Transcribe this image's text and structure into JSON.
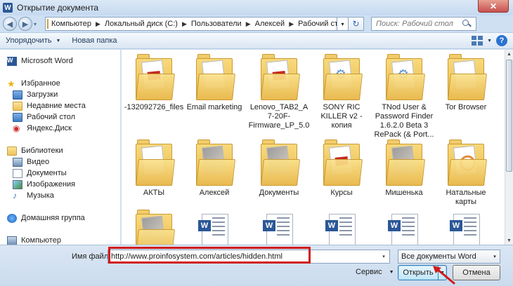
{
  "window": {
    "title": "Открытие документа",
    "close_glyph": "✕"
  },
  "nav_buttons": {
    "back": "◀",
    "forward": "▶",
    "dropdown": "▾"
  },
  "address": {
    "crumbs": [
      "Компьютер",
      "Локальный диск (C:)",
      "Пользователи",
      "Алексей",
      "Рабочий стол"
    ],
    "separator": "▶",
    "dropdown": "▾",
    "refresh": "↻"
  },
  "search": {
    "placeholder": "Поиск: Рабочий стол"
  },
  "toolbar": {
    "organize": "Упорядочить",
    "organize_caret": "▼",
    "new_folder": "Новая папка",
    "view_caret": "▼",
    "help": "?"
  },
  "nav_pane": {
    "items": [
      {
        "label": "Microsoft Word",
        "icon": "word-icon"
      },
      {
        "label": "Избранное",
        "icon": "star-icon"
      },
      {
        "label": "Загрузки",
        "icon": "downloads-folder-icon"
      },
      {
        "label": "Недавние места",
        "icon": "recent-places-icon"
      },
      {
        "label": "Рабочий стол",
        "icon": "desktop-icon"
      },
      {
        "label": "Яндекс.Диск",
        "icon": "yandex-disk-icon"
      },
      {
        "label": "Библиотеки",
        "icon": "libraries-icon"
      },
      {
        "label": "Видео",
        "icon": "video-library-icon"
      },
      {
        "label": "Документы",
        "icon": "documents-library-icon"
      },
      {
        "label": "Изображения",
        "icon": "pictures-library-icon"
      },
      {
        "label": "Музыка",
        "icon": "music-library-icon"
      },
      {
        "label": "Домашняя группа",
        "icon": "homegroup-icon"
      },
      {
        "label": "Компьютер",
        "icon": "computer-icon"
      }
    ]
  },
  "files": [
    {
      "label": "-132092726_files",
      "type": "folder",
      "preview": "pdf"
    },
    {
      "label": "Email marketing",
      "type": "folder",
      "preview": "paper"
    },
    {
      "label": "Lenovo_TAB2_A7-20F-Firmware_LP_5.0",
      "type": "folder",
      "preview": "pdf"
    },
    {
      "label": "SONY RIC KILLER v2 - копия",
      "type": "folder",
      "preview": "gear"
    },
    {
      "label": "TNod User & Password Finder 1.6.2.0 Beta 3 RePack (& Port...",
      "type": "folder",
      "preview": "gear"
    },
    {
      "label": "Tor Browser",
      "type": "folder",
      "preview": "paper"
    },
    {
      "label": "АКТЫ",
      "type": "folder",
      "preview": "paper"
    },
    {
      "label": "Алексей",
      "type": "folder",
      "preview": "photo"
    },
    {
      "label": "Документы",
      "type": "folder",
      "preview": "photo"
    },
    {
      "label": "Курсы",
      "type": "folder",
      "preview": "pdf"
    },
    {
      "label": "Мишенька",
      "type": "folder",
      "preview": "photo"
    },
    {
      "label": "Натальные карты",
      "type": "folder",
      "preview": "dial"
    },
    {
      "label": "",
      "type": "folder",
      "preview": "photo"
    },
    {
      "label": "",
      "type": "docx",
      "preview": "word"
    },
    {
      "label": "",
      "type": "docx",
      "preview": "word"
    },
    {
      "label": "",
      "type": "docx",
      "preview": "word"
    },
    {
      "label": "",
      "type": "docx",
      "preview": "word"
    },
    {
      "label": "",
      "type": "docx",
      "preview": "word"
    }
  ],
  "word_badge": "W",
  "scrollbar": {
    "up": "▲",
    "down": "▼"
  },
  "bottom": {
    "filename_label": "Имя файла:",
    "filename_value": "http://www.proinfosystem.com/articles/hidden.html",
    "filename_dropdown": "▾",
    "filetype": "Все документы Word",
    "filetype_dropdown": "▾",
    "service": "Сервис",
    "service_caret": "▼",
    "open": "Открыть",
    "open_split": "▼",
    "cancel": "Отмена"
  },
  "annotation_color": "#d21a1a"
}
